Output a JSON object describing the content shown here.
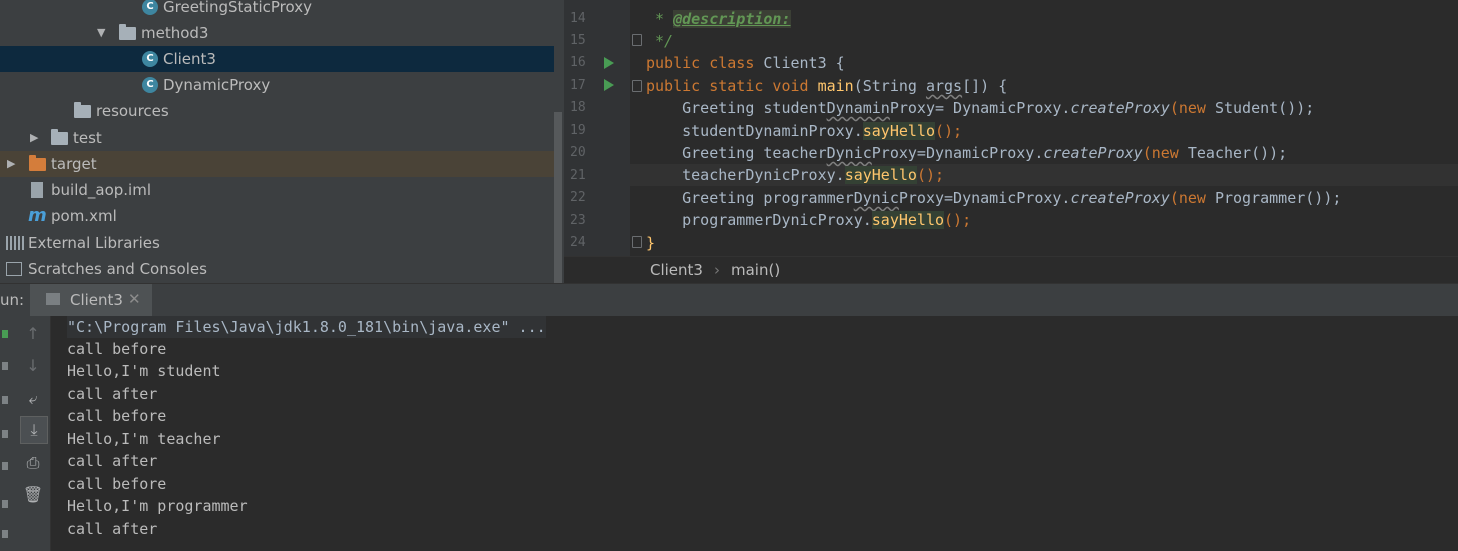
{
  "project_tree": {
    "items": [
      {
        "label": "GreetingStaticProxy",
        "icon": "class-icon"
      },
      {
        "label": "method3",
        "icon": "package-folder-icon"
      },
      {
        "label": "Client3",
        "icon": "class-icon"
      },
      {
        "label": "DynamicProxy",
        "icon": "class-icon"
      },
      {
        "label": "resources",
        "icon": "resources-folder-icon"
      },
      {
        "label": "test",
        "icon": "folder-icon"
      },
      {
        "label": "target",
        "icon": "excluded-folder-icon"
      },
      {
        "label": "build_aop.iml",
        "icon": "module-file-icon"
      },
      {
        "label": "pom.xml",
        "icon": "maven-icon"
      },
      {
        "label": "External Libraries",
        "icon": "libraries-icon"
      },
      {
        "label": "Scratches and Consoles",
        "icon": "scratches-icon"
      }
    ],
    "class_icon_letter": "C",
    "maven_icon_letter": "m"
  },
  "editor": {
    "line_numbers": [
      "14",
      "15",
      "16",
      "17",
      "18",
      "19",
      "20",
      "21",
      "22",
      "23",
      "24"
    ],
    "lines": {
      "l14_star": " * ",
      "l14_tag": "@description:",
      "l15": " */",
      "l16_kw": "public class ",
      "l16_rest": "Client3 {",
      "l17_kw": "public static void ",
      "l17_fn": "main",
      "l17_a": "(String ",
      "l17_args": "args",
      "l17_b": "[]) {",
      "l18_a": "    Greeting student",
      "l18_u": "Dynamin",
      "l18_b": "Proxy= DynamicProxy.",
      "l18_m": "createProxy",
      "l18_c": "(",
      "l18_new": "new ",
      "l18_d": "Student());",
      "l19_a": "    studentDynaminProxy.",
      "l19_m": "sayHello",
      "l19_b": "();",
      "l20_a": "    Greeting teacher",
      "l20_u": "Dynic",
      "l20_b": "Proxy=DynamicProxy.",
      "l20_m": "createProxy",
      "l20_c": "(",
      "l20_new": "new ",
      "l20_d": "Teacher());",
      "l21_a": "    teacherDynicProxy.",
      "l21_m": "sayHello",
      "l21_b": "();",
      "l22_a": "    Greeting programmer",
      "l22_u": "Dynic",
      "l22_b": "Proxy=DynamicProxy.",
      "l22_m": "createProxy",
      "l22_c": "(",
      "l22_new": "new ",
      "l22_d": "Programmer());",
      "l23_a": "    programmerDynicProxy.",
      "l23_m": "sayHello",
      "l23_b": "();",
      "l24": "}"
    }
  },
  "breadcrumb": {
    "class": "Client3",
    "separator": "›",
    "method": "main()"
  },
  "run_panel": {
    "label": "un:",
    "tab_title": "Client3",
    "tab_close": "✕",
    "output": [
      "\"C:\\Program Files\\Java\\jdk1.8.0_181\\bin\\java.exe\" ...",
      "call before",
      "Hello,I'm student",
      "call after",
      "call before",
      "Hello,I'm teacher",
      "call after",
      "call before",
      "Hello,I'm programmer",
      "call after"
    ]
  },
  "colors": {
    "keyword": "#cc7832",
    "method": "#ffc66d",
    "comment_tag": "#629755",
    "selection": "#0d293e",
    "tab_underline": "#4a88c7"
  }
}
